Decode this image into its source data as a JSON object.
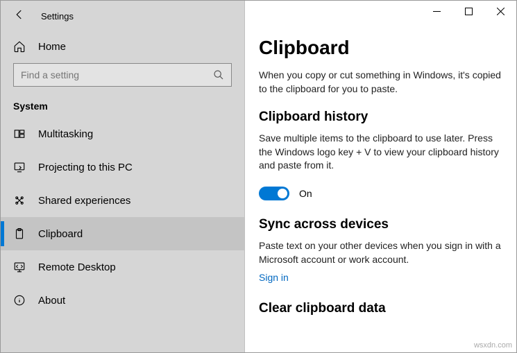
{
  "header": {
    "back_aria": "Back",
    "title": "Settings"
  },
  "sidebar": {
    "home_label": "Home",
    "search_placeholder": "Find a setting",
    "section_label": "System",
    "items": [
      {
        "label": "Multitasking",
        "selected": false,
        "icon": "multitasking-icon"
      },
      {
        "label": "Projecting to this PC",
        "selected": false,
        "icon": "projecting-icon"
      },
      {
        "label": "Shared experiences",
        "selected": false,
        "icon": "shared-icon"
      },
      {
        "label": "Clipboard",
        "selected": true,
        "icon": "clipboard-icon"
      },
      {
        "label": "Remote Desktop",
        "selected": false,
        "icon": "remote-desktop-icon"
      },
      {
        "label": "About",
        "selected": false,
        "icon": "about-icon"
      }
    ]
  },
  "main": {
    "title": "Clipboard",
    "intro": "When you copy or cut something in Windows, it's copied to the clipboard for you to paste.",
    "history": {
      "heading": "Clipboard history",
      "desc": "Save multiple items to the clipboard to use later. Press the Windows logo key + V to view your clipboard history and paste from it.",
      "toggle_state": "On"
    },
    "sync": {
      "heading": "Sync across devices",
      "desc": "Paste text on your other devices when you sign in with a Microsoft account or work account.",
      "link": "Sign in"
    },
    "clear": {
      "heading": "Clear clipboard data"
    }
  },
  "watermark": "wsxdn.com"
}
